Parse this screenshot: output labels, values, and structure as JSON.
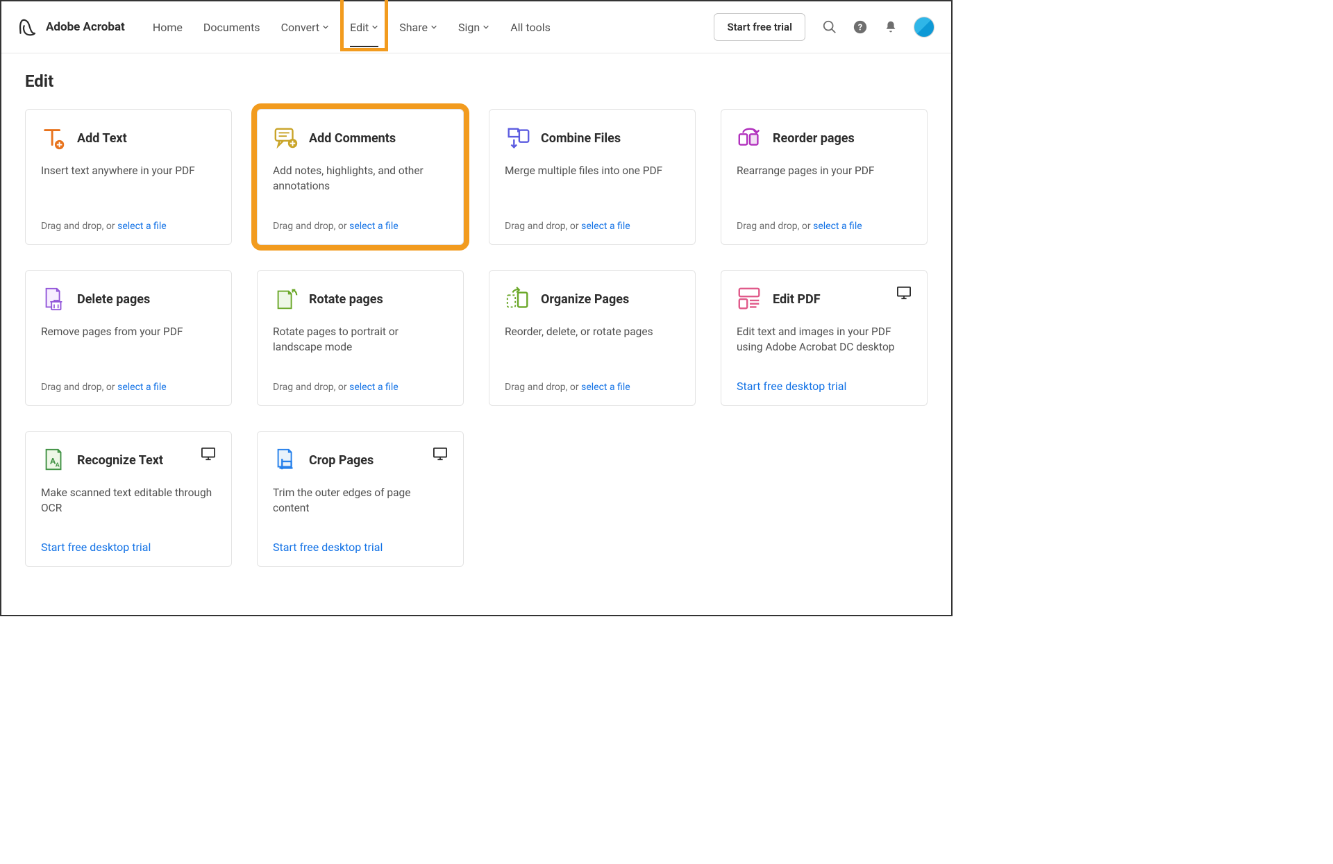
{
  "header": {
    "app_name": "Adobe Acrobat",
    "nav": [
      {
        "label": "Home",
        "dropdown": false,
        "active": false
      },
      {
        "label": "Documents",
        "dropdown": false,
        "active": false
      },
      {
        "label": "Convert",
        "dropdown": true,
        "active": false
      },
      {
        "label": "Edit",
        "dropdown": true,
        "active": true
      },
      {
        "label": "Share",
        "dropdown": true,
        "active": false
      },
      {
        "label": "Sign",
        "dropdown": true,
        "active": false
      },
      {
        "label": "All tools",
        "dropdown": false,
        "active": false
      }
    ],
    "cta_label": "Start free trial"
  },
  "page": {
    "title": "Edit"
  },
  "cards": [
    {
      "title": "Add Text",
      "desc": "Insert text anywhere in your PDF",
      "dnd_prefix": "Drag and drop, or ",
      "link": "select a file"
    },
    {
      "title": "Add Comments",
      "desc": "Add notes, highlights, and other annotations",
      "dnd_prefix": "Drag and drop, or ",
      "link": "select a file"
    },
    {
      "title": "Combine Files",
      "desc": "Merge multiple files into one PDF",
      "dnd_prefix": "Drag and drop, or ",
      "link": "select a file"
    },
    {
      "title": "Reorder pages",
      "desc": "Rearrange pages in your PDF",
      "dnd_prefix": "Drag and drop, or ",
      "link": "select a file"
    },
    {
      "title": "Delete pages",
      "desc": "Remove pages from your PDF",
      "dnd_prefix": "Drag and drop, or ",
      "link": "select a file"
    },
    {
      "title": "Rotate pages",
      "desc": "Rotate pages to portrait or landscape mode",
      "dnd_prefix": "Drag and drop, or ",
      "link": "select a file"
    },
    {
      "title": "Organize Pages",
      "desc": "Reorder, delete, or rotate pages",
      "dnd_prefix": "Drag and drop, or ",
      "link": "select a file"
    },
    {
      "title": "Edit PDF",
      "desc": "Edit text and images in your PDF using Adobe Acrobat DC desktop",
      "solo_link": "Start free desktop trial",
      "desktop": true
    },
    {
      "title": "Recognize Text",
      "desc": "Make scanned text editable through OCR",
      "solo_link": "Start free desktop trial",
      "desktop": true
    },
    {
      "title": "Crop Pages",
      "desc": "Trim the outer edges of page content",
      "solo_link": "Start free desktop trial",
      "desktop": true
    }
  ]
}
